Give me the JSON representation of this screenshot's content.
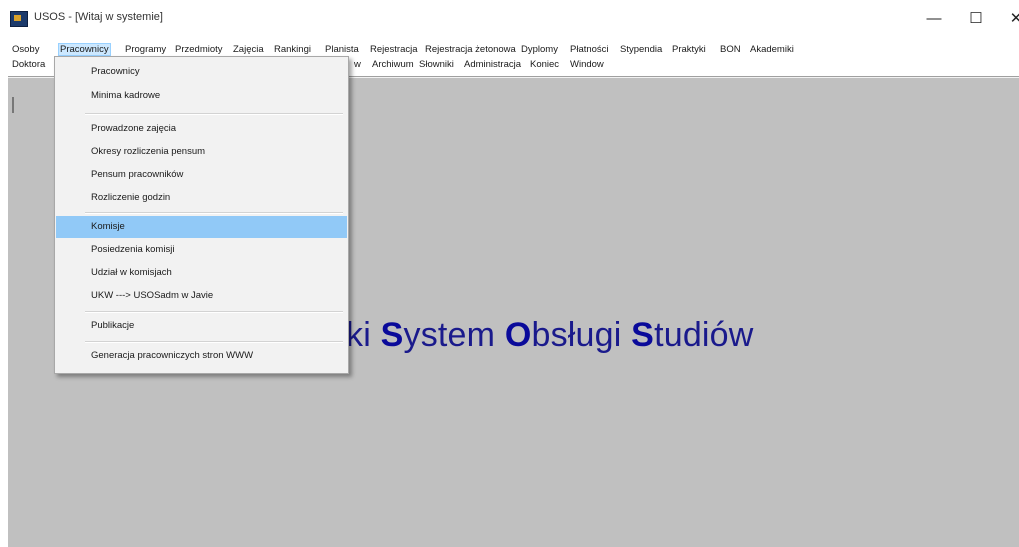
{
  "window": {
    "title": "USOS - [Witaj w systemie]",
    "minimize_glyph": "—",
    "maximize_glyph": "☐",
    "close_glyph": "✕"
  },
  "menubar": {
    "row1": [
      "Osoby",
      "Pracownicy",
      "Programy",
      "Przedmioty",
      "Zajęcia",
      "Rankingi",
      "Planista",
      "Rejestracja",
      "Rejestracja żetonowa",
      "Dyplomy",
      "Płatności",
      "Stypendia",
      "Praktyki",
      "BON",
      "Akademiki"
    ],
    "row2": [
      "Doktora",
      "w",
      "Archiwum",
      "Słowniki",
      "Administracja",
      "Koniec",
      "Window"
    ],
    "active": "Pracownicy"
  },
  "dropdown": {
    "items": [
      "Pracownicy",
      "Minima kadrowe",
      "Prowadzone zajęcia",
      "Okresy rozliczenia pensum",
      "Pensum pracowników",
      "Rozliczenie godzin",
      "Komisje",
      "Posiedzenia komisji",
      "Udział w komisjach",
      "UKW ---> USOSadm w Javie",
      "Publikacje",
      "Generacja pracowniczych stron WWW"
    ],
    "highlighted": "Komisje"
  },
  "banner": {
    "part1": "ki ",
    "s1": "S",
    "part2": "ystem ",
    "o": "O",
    "part3": "bsługi ",
    "s2": "S",
    "part4": "tudiów"
  },
  "colors": {
    "client_bg": "#c0c0c0",
    "banner_text": "#1a1a8c",
    "menu_highlight": "#91c9f7"
  },
  "icons": {
    "app": "usos-app-icon"
  }
}
